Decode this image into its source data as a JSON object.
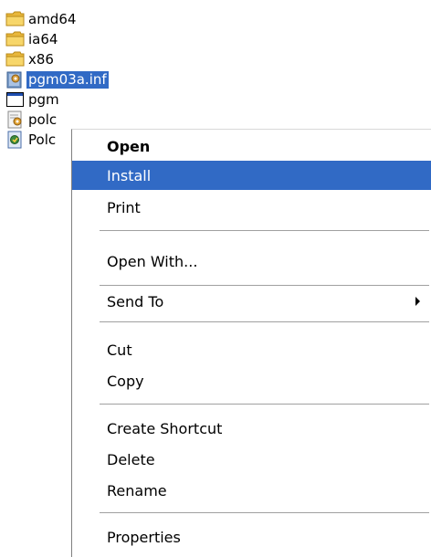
{
  "files": [
    {
      "name": "amd64",
      "icon": "folder-icon"
    },
    {
      "name": "ia64",
      "icon": "folder-icon"
    },
    {
      "name": "x86",
      "icon": "folder-icon"
    },
    {
      "name": "pgm03a.inf",
      "icon": "setup-information-icon",
      "selected": true
    },
    {
      "name": "pgm",
      "icon": "window-icon"
    },
    {
      "name": "polc",
      "icon": "setup-information-icon"
    },
    {
      "name": "Polc",
      "icon": "security-catalog-icon"
    }
  ],
  "context_menu": {
    "open": "Open",
    "install": "Install",
    "print": "Print",
    "open_with": "Open With...",
    "send_to": "Send To",
    "cut": "Cut",
    "copy": "Copy",
    "create_shortcut": "Create Shortcut",
    "delete": "Delete",
    "rename": "Rename",
    "properties": "Properties"
  },
  "colors": {
    "selection": "#316ac5",
    "folder": "#f0c850",
    "separator": "#a0a0a0"
  }
}
